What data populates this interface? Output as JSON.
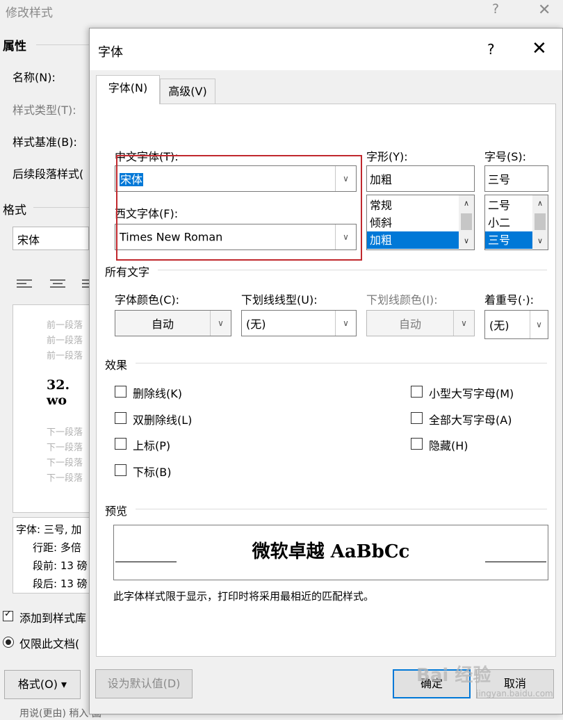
{
  "background_dialog": {
    "title": "修改样式",
    "help_icon": "?",
    "close_icon": "✕",
    "attributes_heading": "属性",
    "name_label": "名称(N):",
    "style_type_label": "样式类型(T):",
    "style_based_on_label": "样式基准(B):",
    "next_para_style_label": "后续段落样式(",
    "format_heading": "格式",
    "font_value": "宋体",
    "preview_prev_lines": [
      "前一段落",
      "前一段落",
      "前一段落"
    ],
    "preview_sample": "32. wo",
    "preview_next_lines": [
      "下一段落",
      "下一段落",
      "下一段落",
      "下一段落"
    ],
    "description_lines": [
      "字体: 三号, 加",
      "行距: 多倍",
      "段前: 13 磅",
      "段后: 13 磅"
    ],
    "add_to_gallery_label": "添加到样式库",
    "only_this_doc_label": "仅限此文档(",
    "format_button_label": "格式(O) ▾",
    "bottom_partial_text": "用说(更由)   稍入   固"
  },
  "font_dialog": {
    "title": "字体",
    "help_icon": "?",
    "close_icon": "✕",
    "tabs": [
      {
        "label": "字体(N)",
        "active": true
      },
      {
        "label": "高级(V)",
        "active": false
      }
    ],
    "chinese_font": {
      "label": "中文字体(T):",
      "value": "宋体"
    },
    "western_font": {
      "label": "西文字体(F):",
      "value": "Times New Roman"
    },
    "font_style": {
      "label": "字形(Y):",
      "value": "加粗",
      "options": [
        "常规",
        "倾斜",
        "加粗"
      ],
      "selected": "加粗"
    },
    "font_size": {
      "label": "字号(S):",
      "value": "三号",
      "options": [
        "二号",
        "小二",
        "三号"
      ],
      "selected": "三号"
    },
    "all_text_heading": "所有文字",
    "font_color": {
      "label": "字体颜色(C):",
      "value": "自动"
    },
    "underline_style": {
      "label": "下划线线型(U):",
      "value": "(无)"
    },
    "underline_color": {
      "label": "下划线颜色(I):",
      "value": "自动"
    },
    "emphasis_mark": {
      "label": "着重号(·):",
      "value": "(无)"
    },
    "effects_heading": "效果",
    "effects_left": [
      "删除线(K)",
      "双删除线(L)",
      "上标(P)",
      "下标(B)"
    ],
    "effects_right": [
      "小型大写字母(M)",
      "全部大写字母(A)",
      "隐藏(H)"
    ],
    "preview_heading": "预览",
    "preview_sample": "微软卓越 AaBbCc",
    "preview_note": "此字体样式限于显示，打印时将采用最相近的匹配样式。",
    "set_default_label": "设为默认值(D)",
    "ok_label": "确定",
    "cancel_label": "取消"
  },
  "watermark": {
    "text": "Bai 经验",
    "url": "jingyan.baidu.com"
  },
  "colors": {
    "selection": "#0078d7",
    "highlight_box": "#c0282d"
  }
}
